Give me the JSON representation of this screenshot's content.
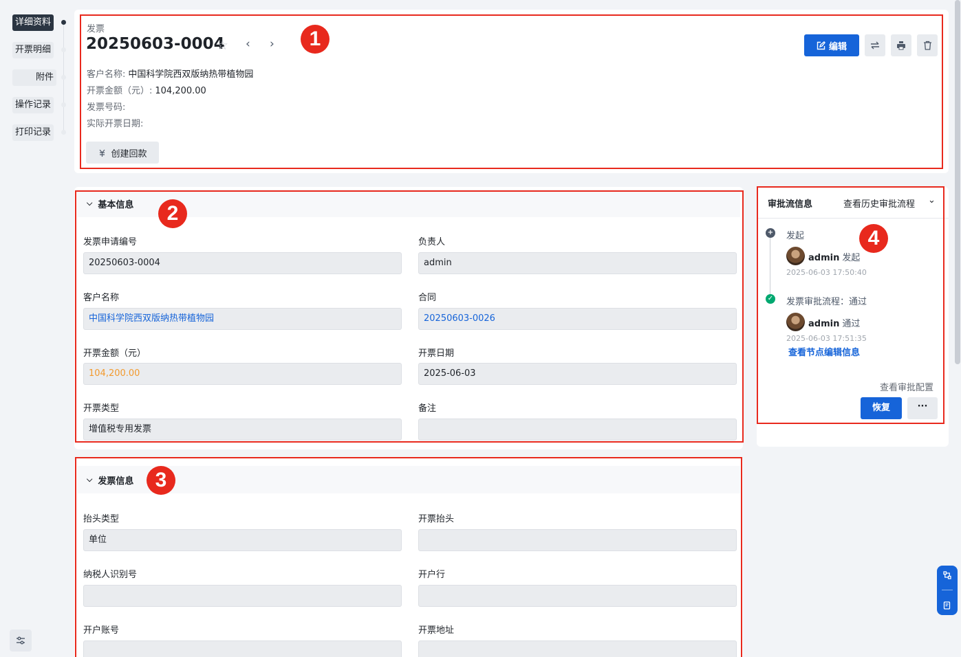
{
  "nav": {
    "items": [
      {
        "label": "详细资料",
        "active": true
      },
      {
        "label": "开票明细",
        "active": false
      },
      {
        "label": "附件",
        "active": false
      },
      {
        "label": "操作记录",
        "active": false
      },
      {
        "label": "打印记录",
        "active": false
      }
    ]
  },
  "header": {
    "type_label": "发票",
    "title": "20250603-0004",
    "prev_icon": "chevron-left",
    "next_icon": "chevron-right",
    "edit_label": "编辑",
    "fields": [
      {
        "label": "客户名称:",
        "value": "中国科学院西双版纳热带植物园"
      },
      {
        "label": "开票金额（元）:",
        "value": "104,200.00"
      },
      {
        "label": "发票号码:",
        "value": ""
      },
      {
        "label": "实际开票日期:",
        "value": ""
      }
    ],
    "create_payment_label": "创建回款"
  },
  "annotations": {
    "badge1": "1",
    "badge2": "2",
    "badge3": "3",
    "badge4": "4",
    "color": "#e8291d"
  },
  "basic_info": {
    "title": "基本信息",
    "fields": [
      {
        "label": "发票申请编号",
        "value": "20250603-0004"
      },
      {
        "label": "负责人",
        "value": "admin"
      },
      {
        "label": "客户名称",
        "value": "中国科学院西双版纳热带植物园"
      },
      {
        "label": "合同",
        "value": "20250603-0026"
      },
      {
        "label": "开票金额（元）",
        "value": "104,200.00"
      },
      {
        "label": "开票日期",
        "value": "2025-06-03"
      },
      {
        "label": "开票类型",
        "value": "增值税专用发票"
      },
      {
        "label": "备注",
        "value": ""
      }
    ]
  },
  "invoice_info": {
    "title": "发票信息",
    "fields": [
      {
        "label": "抬头类型",
        "value": "单位"
      },
      {
        "label": "开票抬头",
        "value": ""
      },
      {
        "label": "纳税人识别号",
        "value": ""
      },
      {
        "label": "开户行",
        "value": ""
      },
      {
        "label": "开户账号",
        "value": ""
      },
      {
        "label": "开票地址",
        "value": ""
      }
    ]
  },
  "approval": {
    "title": "审批流信息",
    "history_label": "查看历史审批流程",
    "steps": [
      {
        "name": "发起",
        "user": "admin",
        "action": "发起",
        "time": "2025-06-03 17:50:40"
      },
      {
        "name": "发票审批流程：通过",
        "user": "admin",
        "action": "通过",
        "time": "2025-06-03 17:51:35"
      }
    ],
    "node_edit_link": "查看节点编辑信息",
    "config_label": "查看审批配置",
    "restore_label": "恢复",
    "more_label": "···"
  },
  "colors": {
    "primary": "#1664d9",
    "amount": "#f29a2e",
    "success": "#00a870"
  }
}
